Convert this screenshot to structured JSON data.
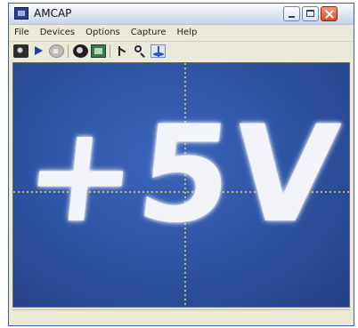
{
  "window": {
    "title": "AMCAP"
  },
  "menu": {
    "items": [
      "File",
      "Devices",
      "Options",
      "Capture",
      "Help"
    ]
  },
  "toolbar": {
    "tools": [
      "camera-icon",
      "play-icon",
      "stop-icon",
      "properties-icon",
      "preview-icon",
      "measure-icon",
      "zoom-icon",
      "crosshair-icon"
    ]
  },
  "viewport": {
    "overlay_text": "+5V"
  }
}
